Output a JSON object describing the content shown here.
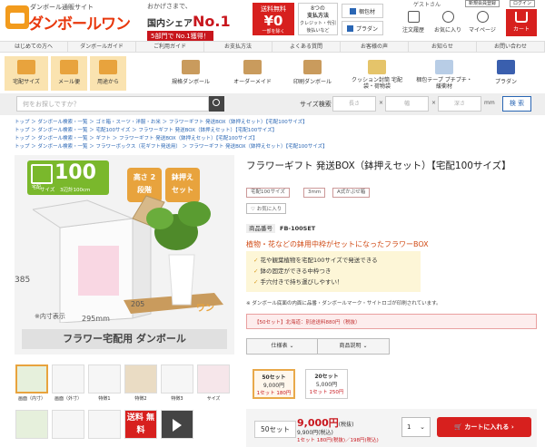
{
  "header": {
    "logo_sub": "ダンボール通販サイト",
    "logo_main": "ダンボールワン",
    "no1_line1": "おかげさまで、",
    "no1_line2": "国内シェア",
    "no1_big": "No.1",
    "no1_line3": "5部門で No.1獲得！",
    "free_line1": "送料無料",
    "free_line2": "¥0",
    "free_line3": "一部を除く",
    "pay_line1": "8つの",
    "pay_line2": "支払方法",
    "pay_line3": "クレジット・代引",
    "pay_line4": "後払いなど",
    "btn_catalog": "梱包材",
    "btn_plaza": "プラダン",
    "guest": "ゲストさん",
    "register": "新規会員登録",
    "login": "ログイン",
    "icon_order": "注文履歴",
    "icon_fav": "お気に入り",
    "icon_mypage": "マイページ",
    "icon_cart": "カート"
  },
  "nav": [
    "はじめての方へ",
    "ダンボールガイド",
    "ご利用ガイド",
    "お支払方法",
    "よくある質問",
    "お客様の声",
    "お知らせ",
    "お問い合わせ"
  ],
  "categories": [
    "宅配サイズ",
    "メール便",
    "用途から",
    "規格ダンボール",
    "オーダーメイド",
    "印刷ダンボール",
    "クッション封筒 宅配袋・荷物袋",
    "梱包テープ プチプチ・緩衝材",
    "プラダン"
  ],
  "search": {
    "placeholder": "何をお探しですか？",
    "size_label": "サイズ検索",
    "length": "長さ",
    "width": "幅",
    "depth": "深さ",
    "unit": "mm",
    "button": "検 索"
  },
  "breadcrumbs": [
    "トップ ＞ ダンボール検索・一覧 ＞ ゴミ箱・スーツ・洋服・お米 ＞ フラワーギフト 発送BOX（鉢押えセット）【宅配100サイズ】",
    "トップ ＞ ダンボール検索・一覧 ＞ 宅配100サイズ ＞ フラワーギフト 発送BOX（鉢押えセット）【宅配100サイズ】",
    "トップ ＞ ダンボール検索・一覧 ＞ ギフト ＞ フラワーギフト 発送BOX（鉢押えセット）【宅配100サイズ】",
    "トップ ＞ ダンボール検索・一覧 ＞ フラワーボックス（花ギフト発送用） ＞ フラワーギフト 発送BOX（鉢押えセット）【宅配100サイズ】"
  ],
  "image": {
    "size_badge_line1": "宅配",
    "size_badge_line2": "サイズ",
    "size_num": "100",
    "size_sub": "3辺計100cm",
    "tag1": "高さ 2段階",
    "tag2": "鉢押え セット",
    "dim1": "385",
    "dim2": "295mm",
    "dim3": "205",
    "inner": "※内寸表示",
    "caption": "フラワー宅配用 ダンボール",
    "brand": "ワン"
  },
  "thumbs": [
    {
      "label": "画面（内寸）"
    },
    {
      "label": "画面（外寸）"
    },
    {
      "label": "特徴1"
    },
    {
      "label": "特徴2"
    },
    {
      "label": "特徴3"
    },
    {
      "label": "サイズ"
    },
    {
      "label": ""
    },
    {
      "label": ""
    },
    {
      "label": ""
    },
    {
      "label": "送料 無料"
    },
    {
      "label": ""
    }
  ],
  "product": {
    "title": "フラワーギフト 発送BOX（鉢押えセット）【宅配100サイズ】",
    "tags": [
      "宅配100サイズ",
      "3mm",
      "A式かぶせ箱"
    ],
    "fav": "お気に入り",
    "code_label": "商品番号",
    "code": "FB-100SET",
    "catch": "植物・花などの鉢用中枠がセットになったフラワーBOX",
    "features": [
      "花や観葉植物を宅配100サイズで発送できる",
      "鉢の固定ができる中枠つき",
      "手穴付きで持ち運びしやすい！"
    ],
    "note": "※ ダンボール底面の内面に品番・ダンボールマーク・サイトロゴが印刷されています。",
    "warn": "【50セット】北海道：別途送料880円（税抜）",
    "dd1": "仕様表",
    "dd2": "商品説明"
  },
  "options": [
    {
      "qty": "50セット",
      "price": "9,000円",
      "unit": "1セット 180円"
    },
    {
      "qty": "20セット",
      "price": "5,000円",
      "unit": "1セット 250円"
    }
  ],
  "buy": {
    "qty_label": "50セット",
    "price": "9,000円",
    "tax_note": "(税抜)",
    "price_tax": "9,900円(税込)",
    "unit_line": "1セット 180円(税抜)／198円(税込)",
    "qty_value": "1",
    "cart_button": "カートに入れる"
  },
  "colors": {
    "accent": "#d7201e",
    "link": "#2a66b4",
    "highlight": "#fae3b0"
  }
}
